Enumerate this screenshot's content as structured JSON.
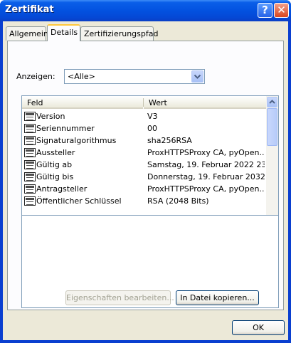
{
  "window": {
    "title": "Zertifikat"
  },
  "title_buttons": {
    "help": "?",
    "close": "✕"
  },
  "tabs": [
    {
      "label": "Allgemein"
    },
    {
      "label": "Details"
    },
    {
      "label": "Zertifizierungspfad"
    }
  ],
  "show": {
    "label": "Anzeigen:",
    "selected": "<Alle>"
  },
  "columns": {
    "field": "Feld",
    "value": "Wert"
  },
  "rows": [
    {
      "field": "Version",
      "value": "V3"
    },
    {
      "field": "Seriennummer",
      "value": "00"
    },
    {
      "field": "Signaturalgorithmus",
      "value": "sha256RSA"
    },
    {
      "field": "Aussteller",
      "value": "ProxHTTPSProxy CA, pyOpen..."
    },
    {
      "field": "Gültig ab",
      "value": "Samstag, 19. Februar 2022 23..."
    },
    {
      "field": "Gültig bis",
      "value": "Donnerstag, 19. Februar 2032..."
    },
    {
      "field": "Antragsteller",
      "value": "ProxHTTPSProxy CA, pyOpen..."
    },
    {
      "field": "Öffentlicher Schlüssel",
      "value": "RSA (2048 Bits)"
    }
  ],
  "buttons": {
    "edit_properties": "Eigenschaften bearbeiten...",
    "copy_to_file": "In Datei kopieren...",
    "ok": "OK"
  },
  "colors": {
    "titlebar": "#0352e0",
    "dialog": "#ece9d8",
    "tab_highlight": "#ffc83c"
  }
}
